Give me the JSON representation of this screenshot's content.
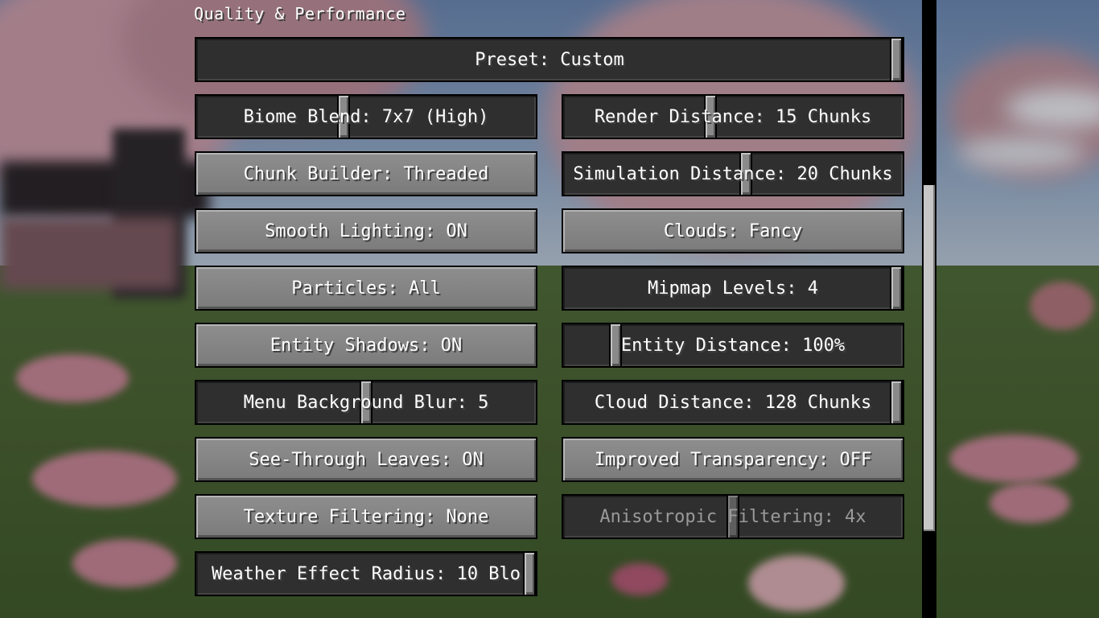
{
  "section_title": "Quality & Performance",
  "preset": {
    "label": "Preset: Custom",
    "value_fraction": 1.0
  },
  "left_column": [
    {
      "type": "slider",
      "label": "Biome Blend: 7x7 (High)",
      "value_fraction": 0.43
    },
    {
      "type": "button",
      "label": "Chunk Builder: Threaded"
    },
    {
      "type": "button",
      "label": "Smooth Lighting: ON"
    },
    {
      "type": "button",
      "label": "Particles: All"
    },
    {
      "type": "button",
      "label": "Entity Shadows: ON"
    },
    {
      "type": "slider",
      "label": "Menu Background Blur: 5",
      "value_fraction": 0.5
    },
    {
      "type": "button",
      "label": "See-Through Leaves: ON"
    },
    {
      "type": "button",
      "label": "Texture Filtering: None"
    },
    {
      "type": "slider",
      "label": "Weather Effect Radius: 10 Blo",
      "value_fraction": 1.0
    }
  ],
  "right_column": [
    {
      "type": "slider",
      "label": "Render Distance: 15 Chunks",
      "value_fraction": 0.43
    },
    {
      "type": "slider",
      "label": "Simulation Distance: 20 Chunks",
      "value_fraction": 0.54
    },
    {
      "type": "button",
      "label": "Clouds: Fancy"
    },
    {
      "type": "slider",
      "label": "Mipmap Levels: 4",
      "value_fraction": 1.0
    },
    {
      "type": "slider",
      "label": "Entity Distance: 100%",
      "value_fraction": 0.14
    },
    {
      "type": "slider",
      "label": "Cloud Distance: 128 Chunks",
      "value_fraction": 1.0
    },
    {
      "type": "button",
      "label": "Improved Transparency: OFF"
    },
    {
      "type": "slider",
      "label": "Anisotropic Filtering: 4x",
      "value_fraction": 0.5,
      "disabled": true
    }
  ],
  "scrollbar": {
    "position_fraction": 0.43
  }
}
